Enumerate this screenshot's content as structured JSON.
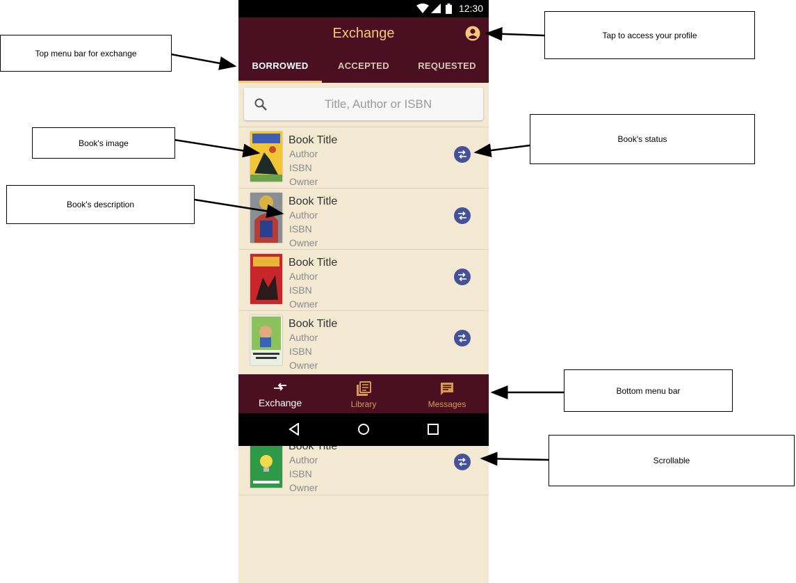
{
  "status_bar": {
    "time": "12:30"
  },
  "app_bar": {
    "title": "Exchange"
  },
  "tabs": [
    {
      "label": "BORROWED",
      "active": true
    },
    {
      "label": "ACCEPTED",
      "active": false
    },
    {
      "label": "REQUESTED",
      "active": false
    }
  ],
  "search": {
    "placeholder": "Title, Author or ISBN"
  },
  "books": [
    {
      "title": "Book Title",
      "author": "Author",
      "isbn": "ISBN",
      "owner": "Owner"
    },
    {
      "title": "Book Title",
      "author": "Author",
      "isbn": "ISBN",
      "owner": "Owner"
    },
    {
      "title": "Book Title",
      "author": "Author",
      "isbn": "ISBN",
      "owner": "Owner"
    },
    {
      "title": "Book Title",
      "author": "Author",
      "isbn": "ISBN",
      "owner": "Owner"
    },
    {
      "title": "Book Title",
      "author": "Author",
      "isbn": "ISBN",
      "owner": "Owner"
    }
  ],
  "bottom_nav": [
    {
      "label": "Exchange",
      "icon": "exchange-icon",
      "active": true
    },
    {
      "label": "Library",
      "icon": "library-icon",
      "active": false
    },
    {
      "label": "Messages",
      "icon": "message-icon",
      "active": false
    }
  ],
  "callouts": {
    "top_menu": "Top menu bar for exchange",
    "profile": "Tap to access your profile",
    "image": "Book's image",
    "status": "Book's status",
    "description": "Book's description",
    "bottom_menu": "Bottom menu bar",
    "scrollable": "Scrollable"
  },
  "colors": {
    "primary": "#4a1022",
    "accent": "#f6c778",
    "background": "#f3e8d1",
    "status_button": "#45529a"
  }
}
